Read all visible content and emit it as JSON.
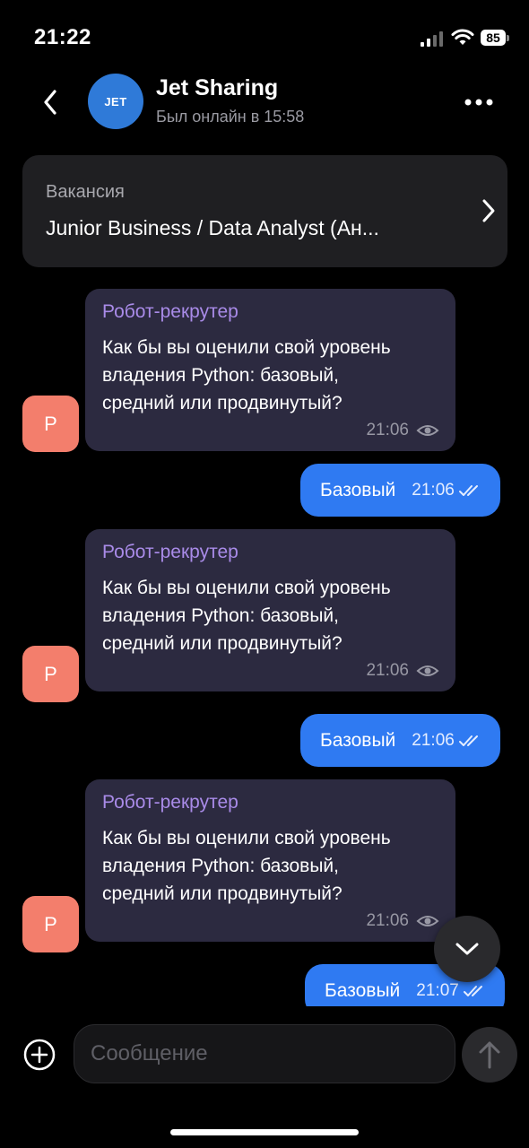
{
  "status_bar": {
    "time": "21:22",
    "battery": "85",
    "icons": [
      "signal-icon",
      "wifi-icon",
      "battery-icon"
    ]
  },
  "header": {
    "avatar_text": "JET",
    "contact_name": "Jet Sharing",
    "contact_status": "Был онлайн в 15:58",
    "icons": [
      "back-chevron-icon",
      "more-dots-icon"
    ]
  },
  "vacancy": {
    "label": "Вакансия",
    "title": "Junior Business / Data Analyst (Ан..."
  },
  "messages": [
    {
      "type": "bot",
      "avatar": "Р",
      "sender": "Робот-рекрутер",
      "lines": [
        "Как бы вы оценили свой уровень",
        "владения Python: базовый,",
        "средний или продвинутый?"
      ],
      "time": "21:06",
      "status_icon": "eye-icon"
    },
    {
      "type": "user",
      "text": "Базовый",
      "time": "21:06",
      "status_icon": "double-check-icon"
    },
    {
      "type": "bot",
      "avatar": "Р",
      "sender": "Робот-рекрутер",
      "lines": [
        "Как бы вы оценили свой уровень",
        "владения Python: базовый,",
        "средний или продвинутый?"
      ],
      "time": "21:06",
      "status_icon": "eye-icon"
    },
    {
      "type": "user",
      "text": "Базовый",
      "time": "21:06",
      "status_icon": "double-check-icon"
    },
    {
      "type": "bot",
      "avatar": "Р",
      "sender": "Робот-рекрутер",
      "lines": [
        "Как бы вы оценили свой уровень",
        "владения Python: базовый,",
        "средний или продвинутый?"
      ],
      "time": "21:06",
      "status_icon": "eye-icon"
    },
    {
      "type": "user",
      "text": "Базовый",
      "time": "21:07",
      "status_icon": "double-check-icon"
    }
  ],
  "composer": {
    "placeholder": "Сообщение",
    "icons": [
      "plus-circle-icon",
      "send-arrow-icon",
      "chevron-down-icon"
    ]
  },
  "colors": {
    "background": "#000000",
    "outgoing_bubble": "#2f7af2",
    "incoming_bubble": "#2c2a40",
    "sender_name": "#a98be8",
    "bot_avatar": "#f37e6c",
    "jet_avatar": "#2f7ad8"
  }
}
